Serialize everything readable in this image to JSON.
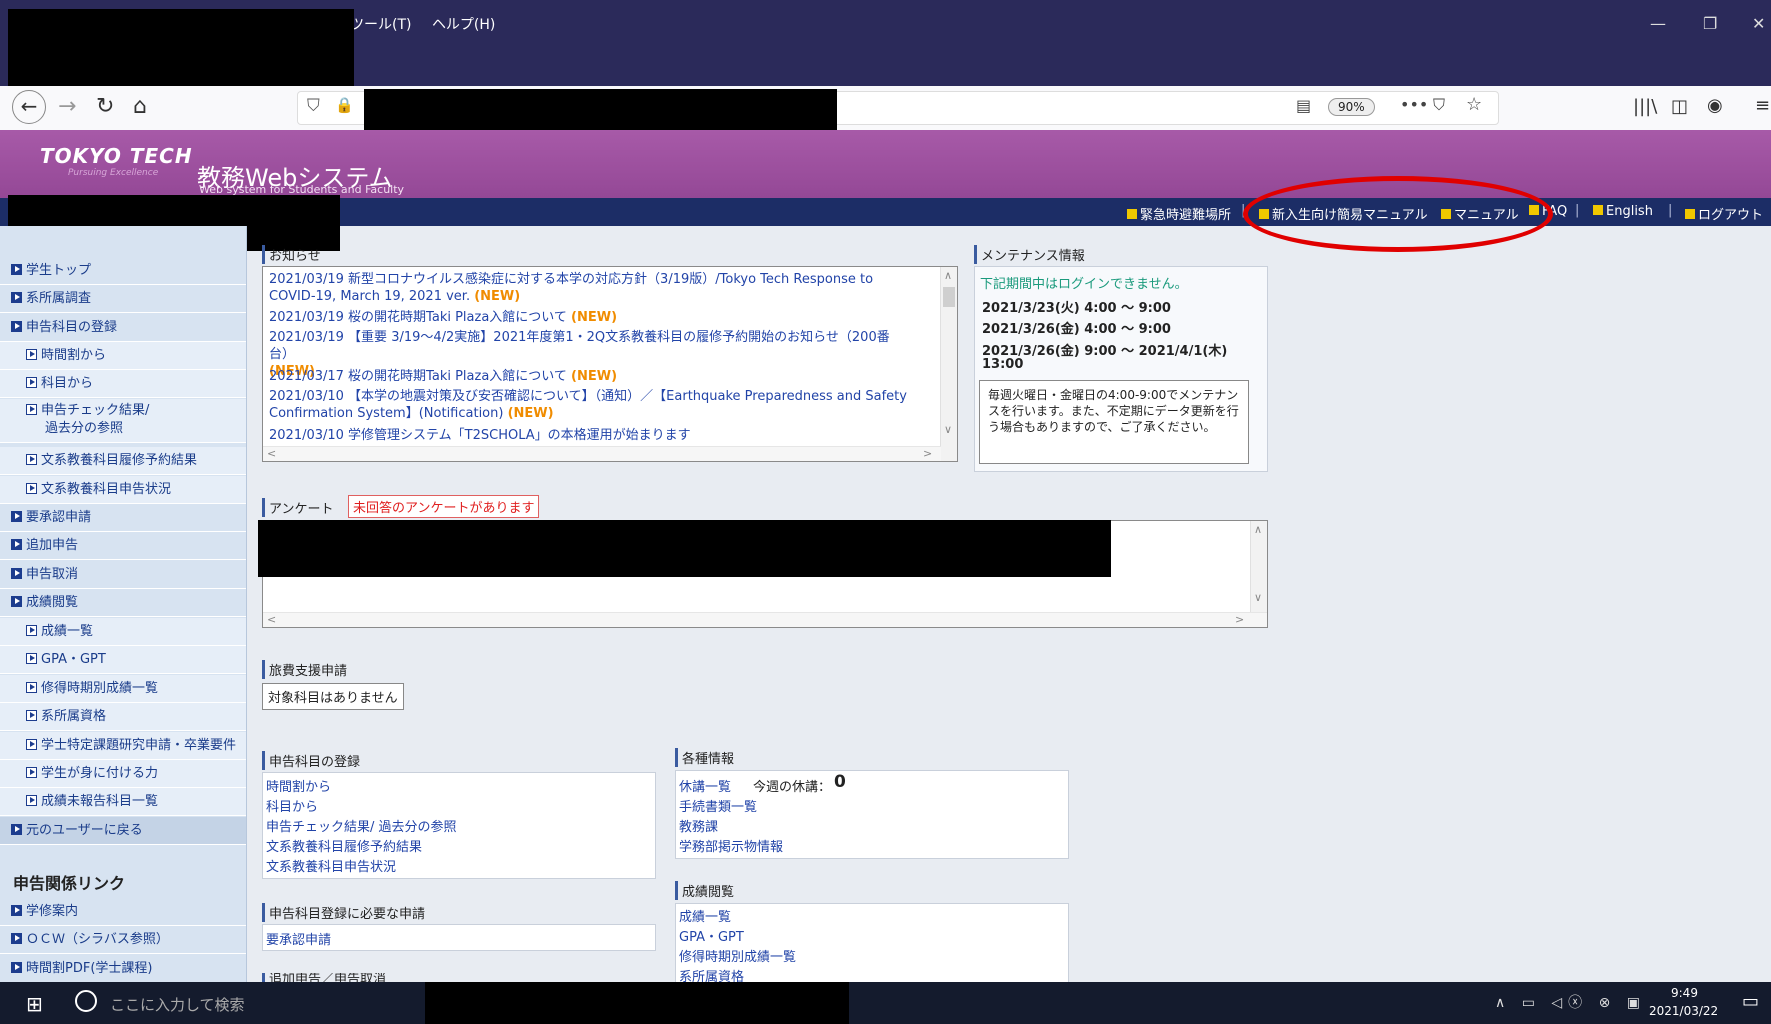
{
  "browser": {
    "menu": [
      "ツール(T)",
      "ヘルプ(H)"
    ],
    "window_controls": [
      "—",
      "❐",
      "✕"
    ],
    "zoom": "90%"
  },
  "site": {
    "logo": "TOKYO TECH",
    "logo_sub": "Pursuing Excellence",
    "title": "教務Webシステム",
    "subtitle": "Web system for Students and Faculty"
  },
  "toplinks": [
    "緊急時避難場所",
    "新入生向け簡易マニュアル",
    "マニュアル",
    "FAQ",
    "English",
    "ログアウト"
  ],
  "sidebar": {
    "items": [
      "学生トップ",
      "系所属調査",
      "申告科目の登録",
      "時間割から",
      "科目から",
      "申告チェック結果/",
      "過去分の参照",
      "文系教養科目履修予約結果",
      "文系教養科目申告状況",
      "要承認申請",
      "追加申告",
      "申告取消",
      "成績閲覧",
      "成績一覧",
      "GPA・GPT",
      "修得時期別成績一覧",
      "系所属資格",
      "学士特定課題研究申請・卒業要件",
      "学生が身に付ける力",
      "成績未報告科目一覧",
      "元のユーザーに戻る"
    ],
    "links_heading": "申告関係リンク",
    "links": [
      "学修案内",
      "ＯＣＷ（シラバス参照）",
      "時間割PDF(学士課程)"
    ]
  },
  "notices": {
    "title": "お知らせ",
    "new_label": "(NEW)",
    "items": [
      "2021/03/19 新型コロナウイルス感染症に対する本学の対応方針（3/19版）/Tokyo Tech Response to COVID-19, March 19, 2021 ver.",
      "2021/03/19 桜の開花時期Taki Plaza入館について",
      "2021/03/19 【重要 3/19～4/2実施】2021年度第1・2Q文系教養科目の履修予約開始のお知らせ（200番台）",
      "2021/03/17 桜の開花時期Taki Plaza入館について",
      "2021/03/10 【本学の地震対策及び安否確認について】（通知）／【Earthquake Preparedness and Safety Confirmation System】(Notification)",
      "2021/03/10 学修管理システム「T2SCHOLA」の本格運用が始まります"
    ]
  },
  "maintenance": {
    "title": "メンテナンス情報",
    "notice": "下記期間中はログインできません。",
    "periods": [
      "2021/3/23(火) 4:00 ～ 9:00",
      "2021/3/26(金) 4:00 ～ 9:00",
      "2021/3/26(金) 9:00 ～ 2021/4/1(木)",
      "13:00"
    ],
    "note": "毎週火曜日・金曜日の4:00-9:00でメンテナンスを行います。また、不定期にデータ更新を行う場合もありますので、ご了承ください。"
  },
  "survey": {
    "title": "アンケート",
    "badge": "未回答のアンケートがあります"
  },
  "travel": {
    "title": "旅費支援申請",
    "value": "対象科目はありません"
  },
  "course_reg": {
    "title": "申告科目の登録",
    "links": [
      "時間割から",
      "科目から",
      "申告チェック結果/ 過去分の参照",
      "文系教養科目履修予約結果",
      "文系教養科目申告状況"
    ]
  },
  "required_app": {
    "title": "申告科目登録に必要な申請",
    "links": [
      "要承認申請"
    ]
  },
  "add_cancel": {
    "title": "追加申告／申告取消"
  },
  "various": {
    "title": "各種情報",
    "links": [
      "休講一覧",
      "手続書類一覧",
      "教務課",
      "学務部掲示物情報"
    ],
    "cancel_today_label": "今週の休講：",
    "cancel_today_count": "0"
  },
  "grades": {
    "title": "成績閲覧",
    "links": [
      "成績一覧",
      "GPA・GPT",
      "修得時期別成績一覧",
      "系所属資格"
    ]
  },
  "taskbar": {
    "search_placeholder": "ここに入力して検索",
    "time": "9:49",
    "date": "2021/03/22"
  }
}
